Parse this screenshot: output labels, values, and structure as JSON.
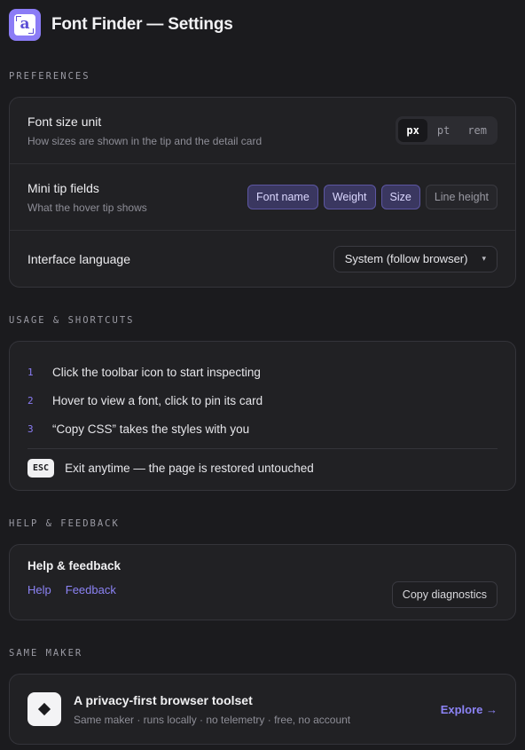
{
  "header": {
    "logo_letter": "a",
    "title": "Font Finder — Settings"
  },
  "preferences": {
    "section_label": "PREFERENCES",
    "font_size_unit": {
      "title": "Font size unit",
      "description": "How sizes are shown in the tip and the detail card",
      "options": [
        "px",
        "pt",
        "rem"
      ],
      "selected": "px"
    },
    "mini_tip_fields": {
      "title": "Mini tip fields",
      "description": "What the hover tip shows",
      "chips": [
        {
          "label": "Font name",
          "on": true
        },
        {
          "label": "Weight",
          "on": true
        },
        {
          "label": "Size",
          "on": true
        },
        {
          "label": "Line height",
          "on": false
        }
      ]
    },
    "interface_language": {
      "title": "Interface language",
      "selected": "System (follow browser)"
    }
  },
  "usage": {
    "section_label": "USAGE & SHORTCUTS",
    "steps": [
      {
        "num": "1",
        "text": "Click the toolbar icon to start inspecting"
      },
      {
        "num": "2",
        "text": "Hover to view a font, click to pin its card"
      },
      {
        "num": "3",
        "text": "“Copy CSS” takes the styles with you"
      }
    ],
    "esc_key": "ESC",
    "esc_text": "Exit anytime — the page is restored untouched"
  },
  "help": {
    "section_label": "HELP & FEEDBACK",
    "title": "Help & feedback",
    "help_link": "Help",
    "feedback_link": "Feedback",
    "copy_button": "Copy diagnostics"
  },
  "maker": {
    "section_label": "SAME MAKER",
    "title": "A privacy-first browser toolset",
    "subtitle": "Same maker · runs locally · no telemetry · free, no account",
    "explore": "Explore →"
  },
  "colors": {
    "background": "#1b1b1e",
    "card": "#212124",
    "accent": "#8b7cf6",
    "link": "#8c83f5"
  }
}
